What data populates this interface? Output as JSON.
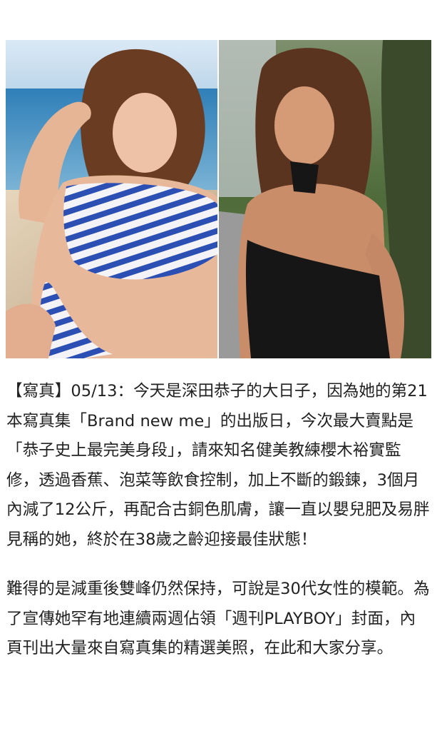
{
  "photos": [
    {
      "name": "photo-beach-striped-bikini",
      "colors": {
        "sky": "#cfe3f2",
        "sea": "#3f8fc4",
        "sand": "#d8c4a6",
        "skin": "#e8b89a",
        "hair": "#6a3d22",
        "stripe": "#2b4fb3"
      }
    },
    {
      "name": "photo-black-halter-road",
      "colors": {
        "trees": "#4f6b3a",
        "road": "#8c8c8c",
        "skin": "#c98d6a",
        "hair": "#5b3420",
        "dress": "#161616"
      }
    }
  ],
  "article": {
    "paragraphs": [
      "【寫真】05/13：今天是深田恭子的大日子，因為她的第21本寫真集「Brand new me」的出版日，今次最大賣點是「恭子史上最完美身段」，請來知名健美教練櫻木裕實監修，透過香蕉、泡菜等飲食控制，加上不斷的鍛鍊，3個月內減了12公斤，再配合古銅色肌膚，讓一直以嬰兒肥及易胖見稱的她，終於在38歲之齡迎接最佳狀態！",
      "難得的是減重後雙峰仍然保持，可說是30代女性的模範。為了宣傳她罕有地連續兩週佔領「週刊PLAYBOY」封面，內頁刊出大量來自寫真集的精選美照，在此和大家分享。"
    ]
  }
}
